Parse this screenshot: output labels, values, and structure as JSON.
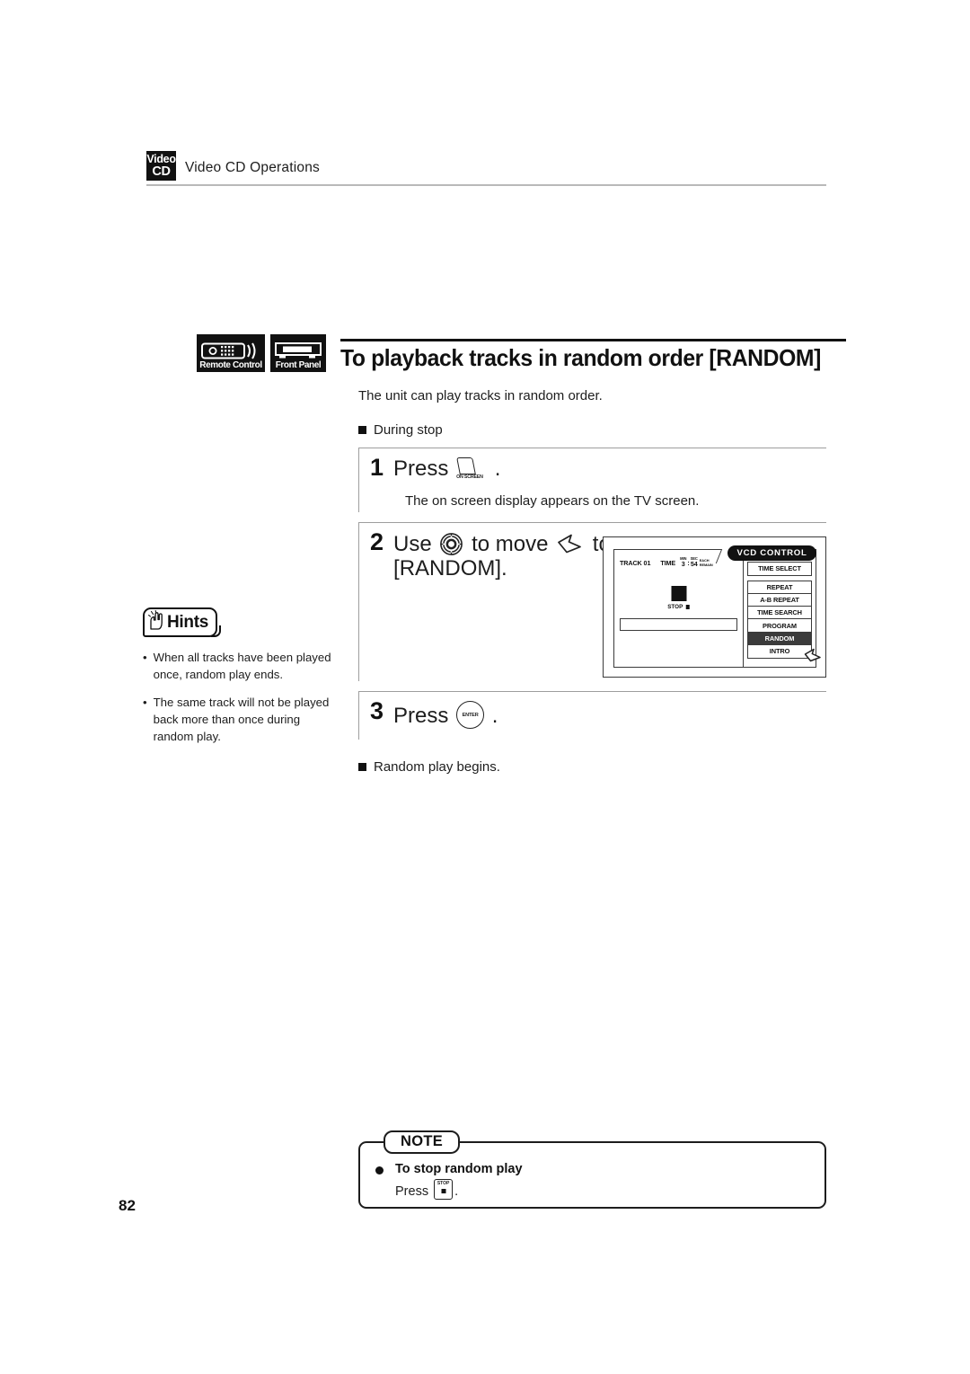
{
  "header": {
    "badge_line1": "Video",
    "badge_line2": "CD",
    "title": "Video CD Operations"
  },
  "section": {
    "tag_remote": "Remote Control",
    "tag_front": "Front Panel",
    "title": "To playback tracks in random order [RANDOM]"
  },
  "body": {
    "intro": "The unit can play tracks in random order.",
    "condition": "During stop"
  },
  "steps": [
    {
      "number": "1",
      "text_before": "Press",
      "key": "on-screen-key",
      "key_label": "ON SCREEN",
      "text_after": ".",
      "description": "The on screen display appears on the TV screen."
    },
    {
      "number": "2",
      "text_before": "Use",
      "key": "jog-dial-key",
      "text_middle": "to move",
      "key2": "cursor-pointer-icon",
      "text_middle2": "to",
      "text_after": "[RANDOM].",
      "description": ""
    },
    {
      "number": "3",
      "text_before": "Press",
      "key": "enter-key",
      "key_label": "ENTER",
      "text_after": ".",
      "description": "Random play begins."
    }
  ],
  "result": "Random play begins.",
  "hints": {
    "label": "Hints",
    "bullet": "•",
    "items": [
      "When all tracks have been played once, random play ends.",
      "The same track will not be played back more than once during random play."
    ]
  },
  "osd": {
    "panel_title": "VCD CONTROL",
    "track_label": "TRACK 01",
    "time_label": "TIME",
    "time_value": "3 : 54",
    "min_label": "MIN",
    "sec_label": "SEC",
    "each_label": "EACH",
    "remain_label": "REMAIN",
    "stop_label": "STOP",
    "buttons": [
      {
        "label": "TIME SELECT",
        "selected": false,
        "spaced": true
      },
      {
        "label": "REPEAT",
        "selected": false,
        "spaced": false
      },
      {
        "label": "A-B REPEAT",
        "selected": false,
        "spaced": false
      },
      {
        "label": "TIME SEARCH",
        "selected": false,
        "spaced": false
      },
      {
        "label": "PROGRAM",
        "selected": false,
        "spaced": false
      },
      {
        "label": "RANDOM",
        "selected": true,
        "spaced": false
      },
      {
        "label": "INTRO",
        "selected": false,
        "spaced": false
      }
    ]
  },
  "note": {
    "tab": "NOTE",
    "title": "To stop random play",
    "press_text": "Press",
    "key_label": "STOP",
    "period": "."
  },
  "page_number": "82"
}
